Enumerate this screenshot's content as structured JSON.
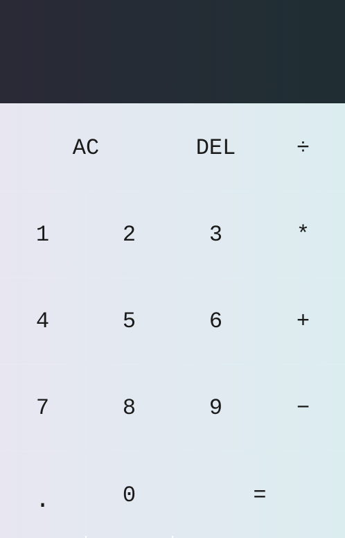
{
  "display": {
    "previous": "",
    "current": ""
  },
  "keys": {
    "ac": "AC",
    "del": "DEL",
    "divide": "÷",
    "one": "1",
    "two": "2",
    "three": "3",
    "multiply": "*",
    "four": "4",
    "five": "5",
    "six": "6",
    "plus": "+",
    "seven": "7",
    "eight": "8",
    "nine": "9",
    "minus": "−",
    "dot": ".",
    "zero": "0",
    "equals": "="
  },
  "colors": {
    "display_bg": "#262d36",
    "key_bg_left": "#e8e7f2",
    "key_bg_right": "#dbeef0",
    "grid_line": "#ffffff"
  }
}
